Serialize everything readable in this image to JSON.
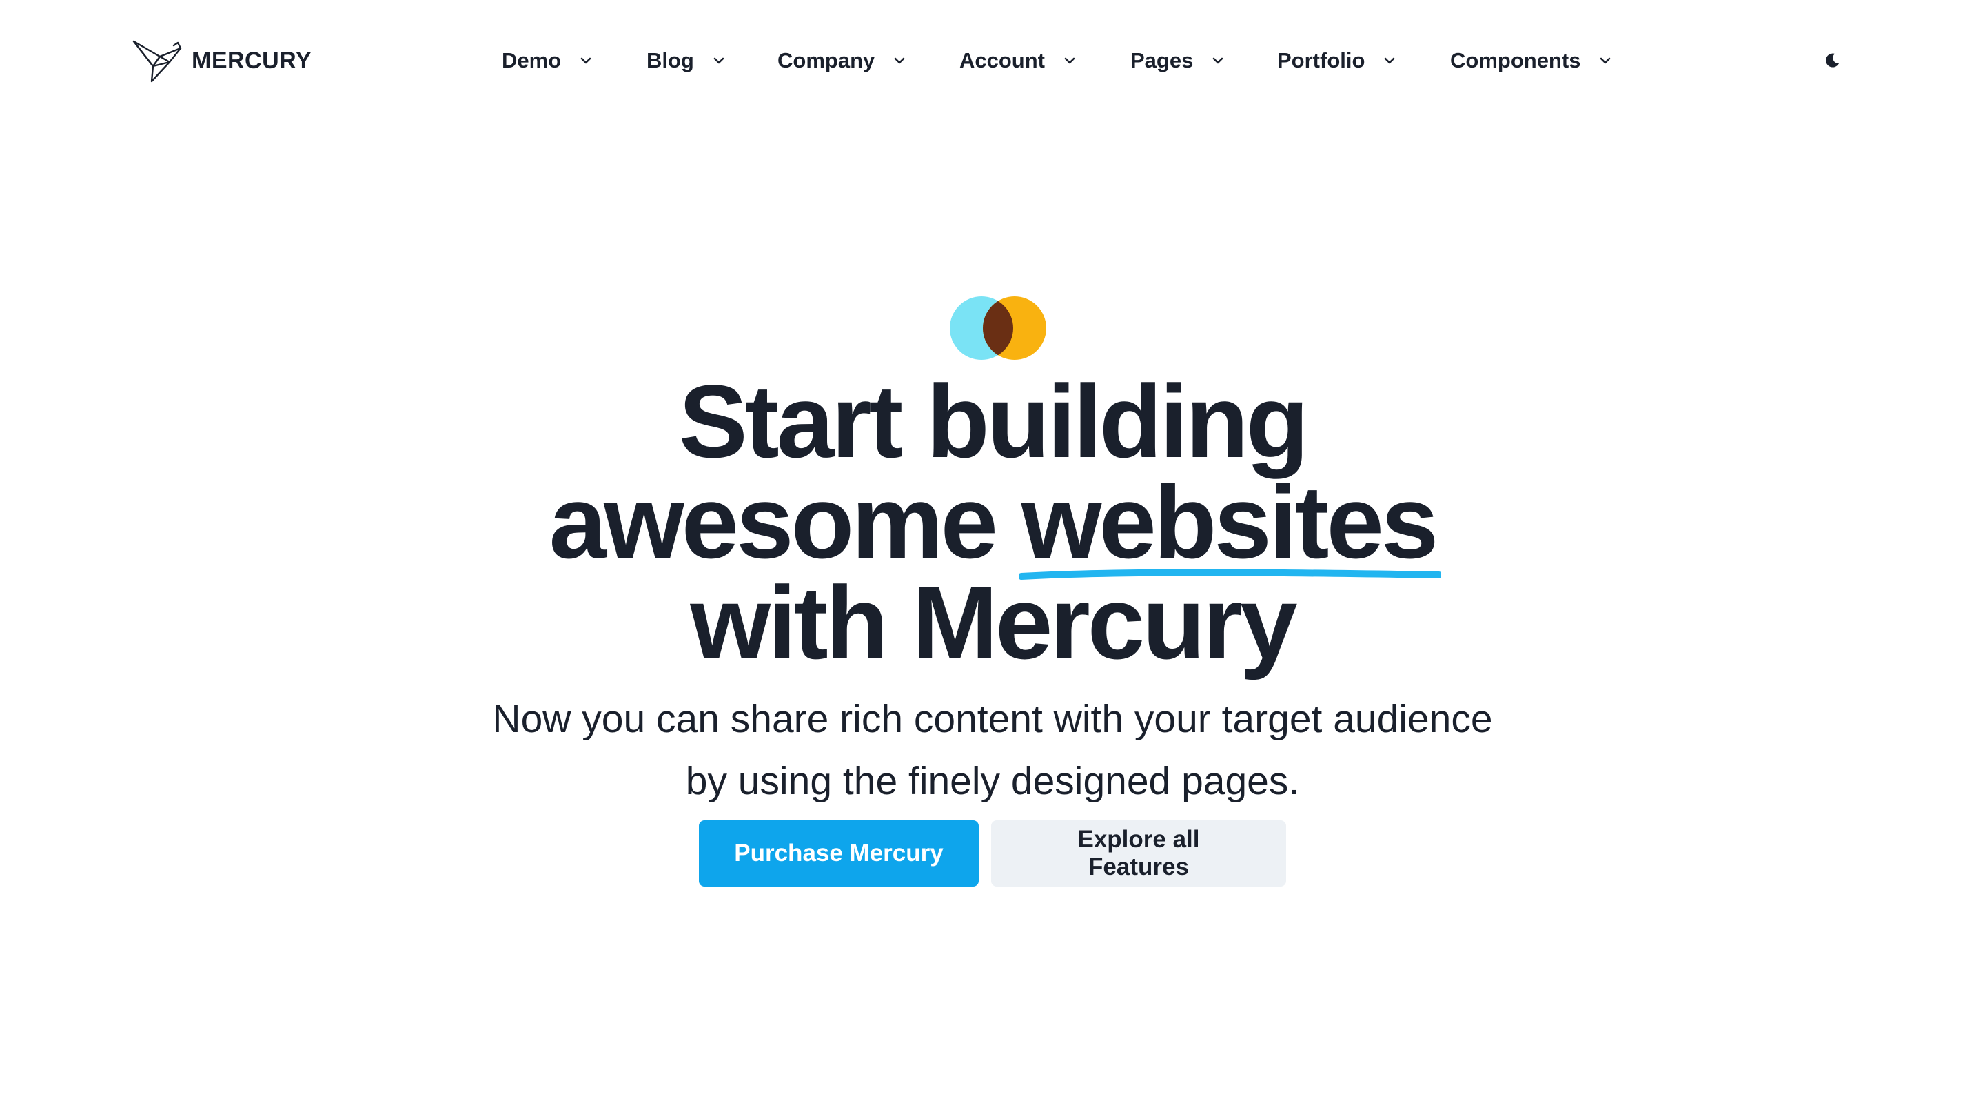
{
  "brand": {
    "name": "MERCURY"
  },
  "nav": {
    "items": [
      {
        "label": "Demo"
      },
      {
        "label": "Blog"
      },
      {
        "label": "Company"
      },
      {
        "label": "Account"
      },
      {
        "label": "Pages"
      },
      {
        "label": "Portfolio"
      },
      {
        "label": "Components"
      }
    ],
    "theme_toggle_icon": "moon-icon"
  },
  "hero": {
    "headline_line1": "Start building",
    "headline_line2_prefix": "awesome",
    "headline_highlight": "websites",
    "headline_line3": "with Mercury",
    "subtitle_line1": "Now you can share rich content with your target audience",
    "subtitle_line2": "by using the finely designed pages.",
    "primary_button": "Purchase Mercury",
    "secondary_button": "Explore all Features"
  },
  "colors": {
    "text": "#1a202c",
    "accent": "#0ea5ec",
    "underline": "#22b5f0",
    "logo_left": "#7ae3f5",
    "logo_right": "#f9b210",
    "logo_overlap": "#6a2f14",
    "secondary_button_bg": "#edf1f5"
  }
}
